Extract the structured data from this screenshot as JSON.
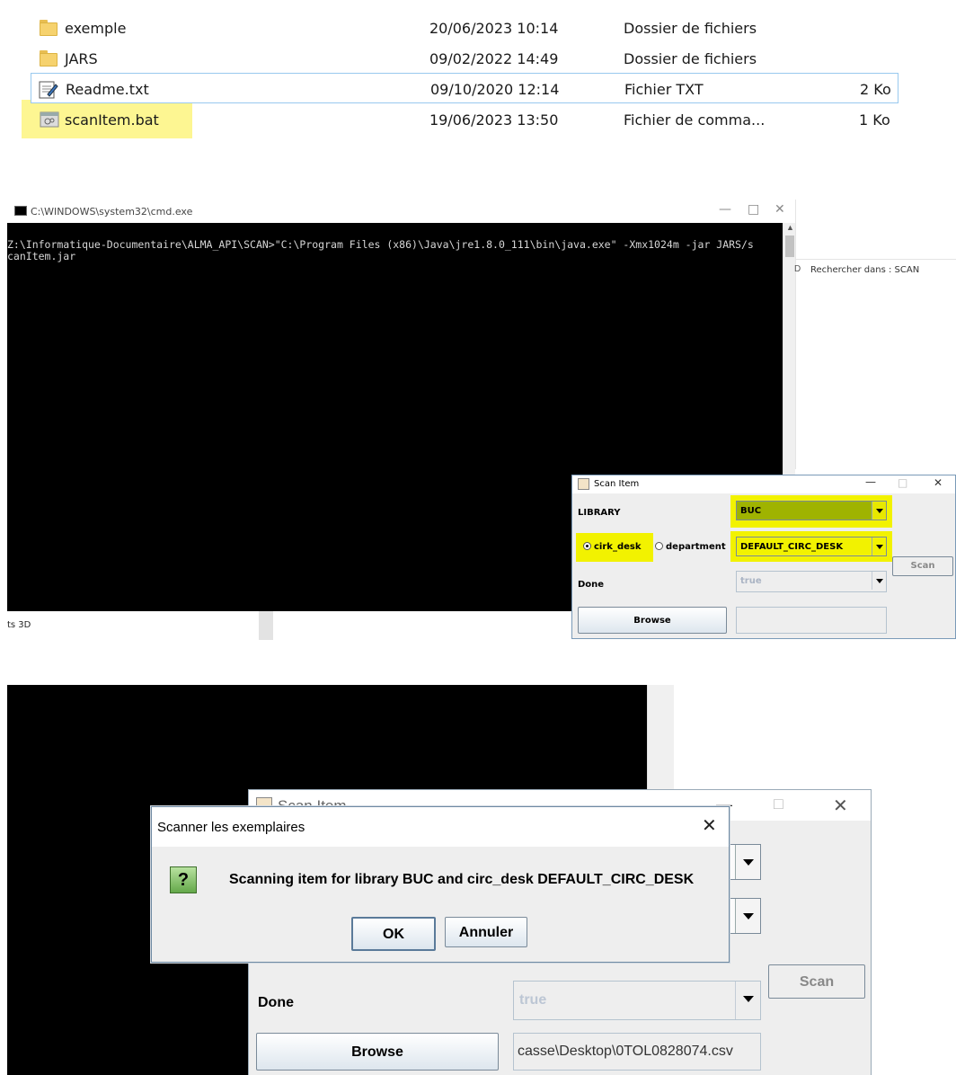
{
  "explorer": {
    "files": [
      {
        "name": "exemple",
        "date": "20/06/2023 10:14",
        "type": "Dossier de fichiers",
        "size": "",
        "icon": "folder-icon"
      },
      {
        "name": "JARS",
        "date": "09/02/2022 14:49",
        "type": "Dossier de fichiers",
        "size": "",
        "icon": "folder-icon"
      },
      {
        "name": "Readme.txt",
        "date": "09/10/2020 12:14",
        "type": "Fichier TXT",
        "size": "2 Ko",
        "icon": "text-file-icon"
      },
      {
        "name": "scanItem.bat",
        "date": "19/06/2023 13:50",
        "type": "Fichier de comma...",
        "size": "1 Ko",
        "icon": "batch-file-icon"
      }
    ],
    "search_placeholder": "Rechercher dans : SCAN",
    "side_fragment": "ts 3D"
  },
  "cmd": {
    "title": "C:\\WINDOWS\\system32\\cmd.exe",
    "lines": [
      "Z:\\Informatique-Documentaire\\ALMA_API\\SCAN>\"C:\\Program Files (x86)\\Java\\jre1.8.0_111\\bin\\java.exe\" -Xmx1024m -jar JARS/s",
      "canItem.jar"
    ]
  },
  "scan_item_small": {
    "title": "Scan Item",
    "library_label": "LIBRARY",
    "library_value": "BUC",
    "radio_circ_desk": "cirk_desk",
    "radio_department": "department",
    "desk_value": "DEFAULT_CIRC_DESK",
    "scan_button": "Scan",
    "done_label": "Done",
    "done_value": "true",
    "browse_button": "Browse",
    "highlight_color": "#f2f200"
  },
  "scan_item_large": {
    "title": "Scan Item",
    "done_label": "Done",
    "done_value": "true",
    "scan_button": "Scan",
    "browse_button": "Browse",
    "file_path": "casse\\Desktop\\0TOL0828074.csv"
  },
  "confirm_dialog": {
    "title": "Scanner les exemplaires",
    "message": "Scanning item for library BUC and circ_desk DEFAULT_CIRC_DESK",
    "ok_button": "OK",
    "cancel_button": "Annuler",
    "icon": "question-icon"
  }
}
